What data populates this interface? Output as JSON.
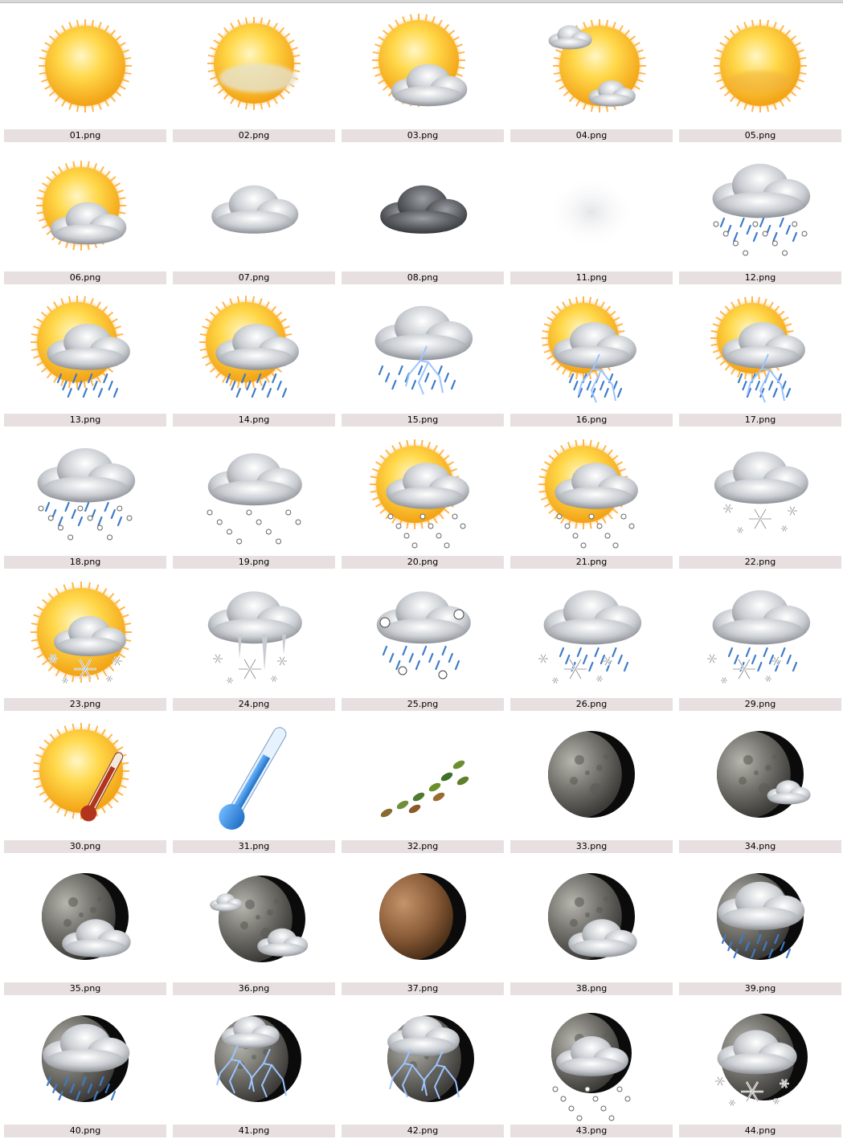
{
  "files": [
    {
      "name": "01.png",
      "icon": "sun-icon"
    },
    {
      "name": "02.png",
      "icon": "sun-haze-icon"
    },
    {
      "name": "03.png",
      "icon": "sun-cloud-icon"
    },
    {
      "name": "04.png",
      "icon": "sun-two-clouds-icon"
    },
    {
      "name": "05.png",
      "icon": "sun-hazy-icon"
    },
    {
      "name": "06.png",
      "icon": "sun-clouds-icon"
    },
    {
      "name": "07.png",
      "icon": "cloud-light-icon"
    },
    {
      "name": "08.png",
      "icon": "cloud-dark-icon"
    },
    {
      "name": "11.png",
      "icon": "fog-icon"
    },
    {
      "name": "12.png",
      "icon": "cloud-sleet-icon"
    },
    {
      "name": "13.png",
      "icon": "sun-cloud-rain-icon"
    },
    {
      "name": "14.png",
      "icon": "sun-cloud-rain-icon"
    },
    {
      "name": "15.png",
      "icon": "cloud-lightning-rain-icon"
    },
    {
      "name": "16.png",
      "icon": "sun-cloud-lightning-icon"
    },
    {
      "name": "17.png",
      "icon": "sun-cloud-lightning-icon"
    },
    {
      "name": "18.png",
      "icon": "cloud-sleet-icon"
    },
    {
      "name": "19.png",
      "icon": "cloud-hail-icon"
    },
    {
      "name": "20.png",
      "icon": "sun-cloud-hail-icon"
    },
    {
      "name": "21.png",
      "icon": "sun-cloud-hail-icon"
    },
    {
      "name": "22.png",
      "icon": "cloud-snow-icon"
    },
    {
      "name": "23.png",
      "icon": "sun-cloud-snow-icon"
    },
    {
      "name": "24.png",
      "icon": "cloud-icicle-snow-icon"
    },
    {
      "name": "25.png",
      "icon": "cloud-rain-hail-icon"
    },
    {
      "name": "26.png",
      "icon": "cloud-rain-snow-icon"
    },
    {
      "name": "29.png",
      "icon": "cloud-rain-snow-icon"
    },
    {
      "name": "30.png",
      "icon": "sun-thermometer-hot-icon"
    },
    {
      "name": "31.png",
      "icon": "thermometer-cold-icon"
    },
    {
      "name": "32.png",
      "icon": "wind-leaves-icon"
    },
    {
      "name": "33.png",
      "icon": "moon-icon"
    },
    {
      "name": "34.png",
      "icon": "moon-small-cloud-icon"
    },
    {
      "name": "35.png",
      "icon": "moon-cloud-icon"
    },
    {
      "name": "36.png",
      "icon": "moon-two-clouds-icon"
    },
    {
      "name": "37.png",
      "icon": "moon-brown-icon"
    },
    {
      "name": "38.png",
      "icon": "moon-cloud-icon"
    },
    {
      "name": "39.png",
      "icon": "moon-cloud-rain-icon"
    },
    {
      "name": "40.png",
      "icon": "moon-cloud-rain-icon"
    },
    {
      "name": "41.png",
      "icon": "moon-lightning-icon"
    },
    {
      "name": "42.png",
      "icon": "moon-cloud-lightning-icon"
    },
    {
      "name": "43.png",
      "icon": "moon-cloud-hail-icon"
    },
    {
      "name": "44.png",
      "icon": "moon-cloud-snow-icon"
    }
  ],
  "colors": {
    "caption_bg": "#e8e0e0",
    "sun": "#f7b727",
    "sun_light": "#ffe58a",
    "cloud": "#b8bcc2",
    "cloud_dark": "#55585c",
    "rain": "#3d7cc9",
    "lightning": "#9cc4ff",
    "moon": "#2a2a2a",
    "moon_surface": "#8a8a86"
  }
}
